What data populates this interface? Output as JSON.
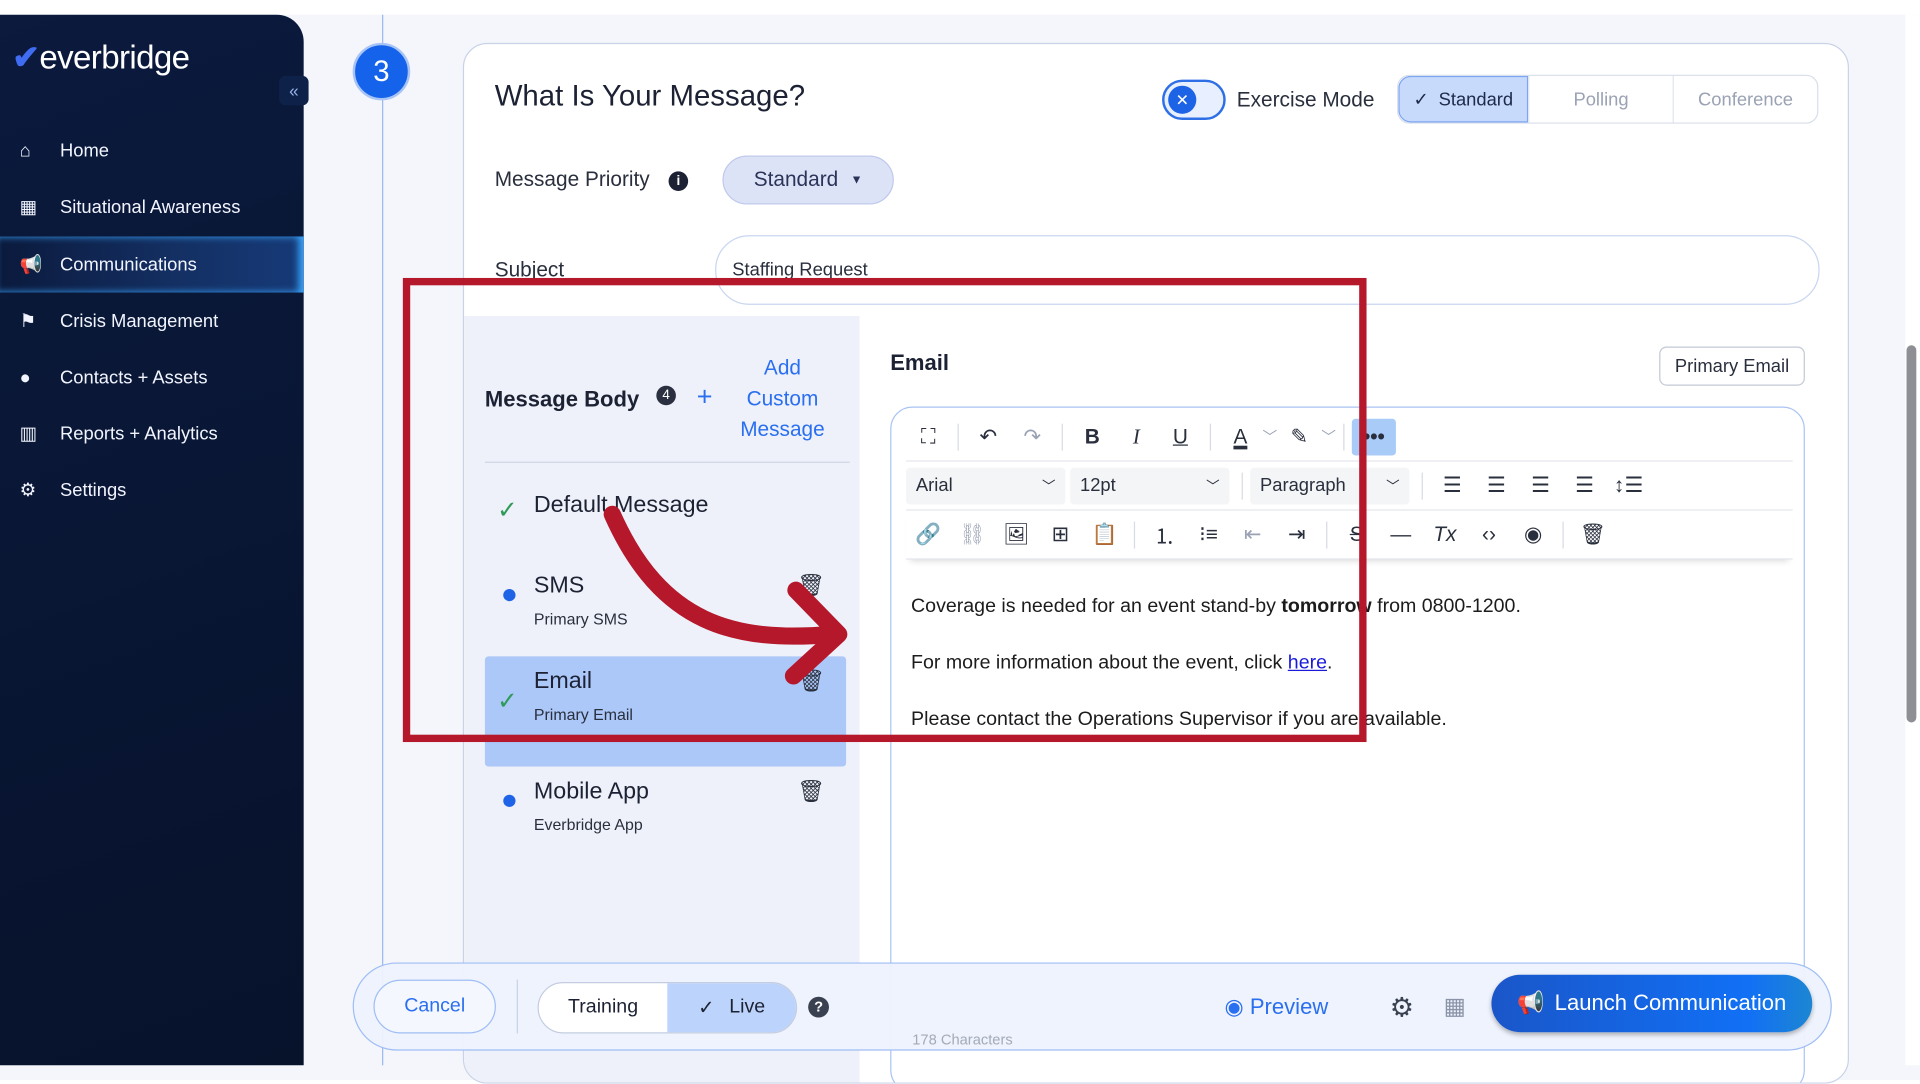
{
  "sidebar": {
    "logo": "everbridge",
    "collapse_icon": "double-chevron-left",
    "items": [
      {
        "label": "Home",
        "icon": "home-icon"
      },
      {
        "label": "Situational Awareness",
        "icon": "map-icon"
      },
      {
        "label": "Communications",
        "icon": "megaphone-icon",
        "active": true
      },
      {
        "label": "Crisis Management",
        "icon": "crisis-icon"
      },
      {
        "label": "Contacts + Assets",
        "icon": "location-pin-icon"
      },
      {
        "label": "Reports + Analytics",
        "icon": "bar-chart-icon"
      },
      {
        "label": "Settings",
        "icon": "gear-icon"
      }
    ]
  },
  "step": "3",
  "header": {
    "title": "What Is Your Message?",
    "exercise_mode_label": "Exercise Mode",
    "exercise_mode_on": false,
    "modes": [
      "Standard",
      "Polling",
      "Conference"
    ],
    "selected_mode": "Standard"
  },
  "priority": {
    "label": "Message Priority",
    "value": "Standard"
  },
  "subject": {
    "label": "Subject",
    "value": "Staffing Request"
  },
  "message_body": {
    "title": "Message Body",
    "count": "4",
    "add_line1": "Add",
    "add_line2": "Custom",
    "add_line3": "Message",
    "items": [
      {
        "name": "Default Message",
        "sub": "",
        "status": "check"
      },
      {
        "name": "SMS",
        "sub": "Primary SMS",
        "status": "dot"
      },
      {
        "name": "Email",
        "sub": "Primary Email",
        "status": "check",
        "selected": true
      },
      {
        "name": "Mobile App",
        "sub": "Everbridge App",
        "status": "dot"
      }
    ]
  },
  "email": {
    "title": "Email",
    "primary_button": "Primary Email",
    "toolbar": {
      "font": "Arial",
      "size": "12pt",
      "block": "Paragraph",
      "more": "•••"
    },
    "content": {
      "p1_before": "Coverage is needed for an event stand-by ",
      "p1_bold": "tomorrow",
      "p1_after": " from 0800-1200.",
      "p2_before": "For more information about the event, click ",
      "p2_link": "here",
      "p2_after": ".",
      "p3": "Please contact the Operations Supervisor if you are available."
    },
    "char_count": "178 Characters"
  },
  "footer": {
    "cancel": "Cancel",
    "training": "Training",
    "live": "Live",
    "selected": "Live",
    "help": "?",
    "preview": "Preview",
    "launch": "Launch Communication"
  },
  "colors": {
    "accent": "#1463ea",
    "highlight_box": "#b5172b",
    "sidebar": "#0b1a3d"
  }
}
